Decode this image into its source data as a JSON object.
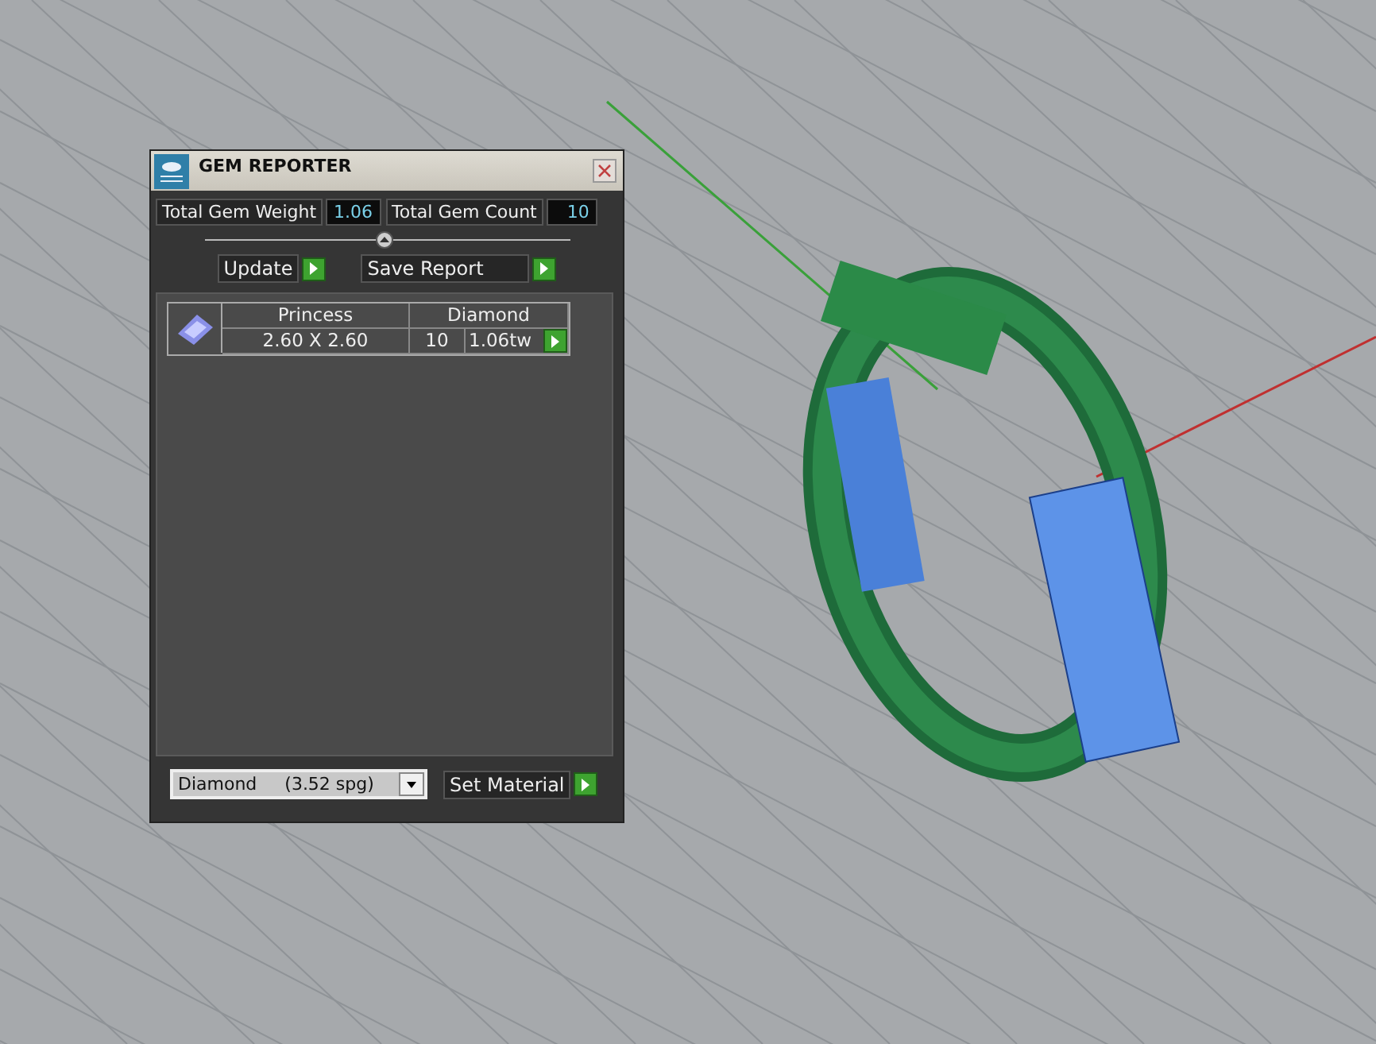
{
  "window": {
    "title": "GEM REPORTER"
  },
  "totals": [
    {
      "label": "Total Gem Weight",
      "value": "1.06"
    },
    {
      "label": "Total Gem Count",
      "value": "10"
    }
  ],
  "actions": [
    "Update",
    "Save Report"
  ],
  "gems": [
    {
      "cut": "Princess",
      "material": "Diamond",
      "size": "2.60 X 2.60",
      "count": "10",
      "weight": "1.06tw"
    }
  ],
  "material_select": {
    "value": "Diamond     (3.52 spg)"
  },
  "set_material": "Set Material"
}
